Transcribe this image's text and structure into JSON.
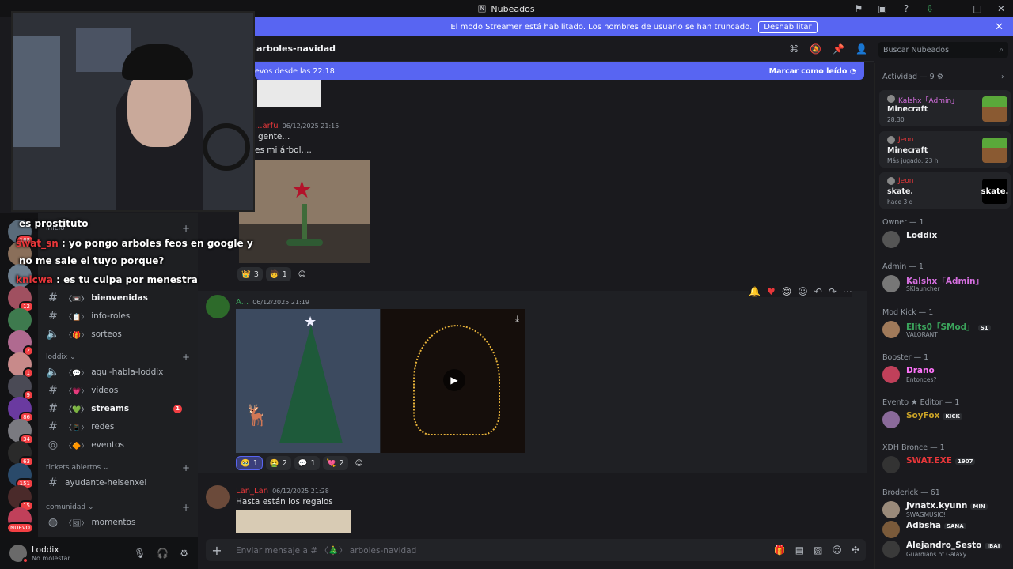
{
  "window": {
    "title": "Nubeados"
  },
  "banner": {
    "text": "El modo Streamer está habilitado. Los nombres de usuario se han truncado.",
    "button": "Deshabilitar"
  },
  "channel_header": {
    "title": "arboles-navidad"
  },
  "search": {
    "placeholder": "Buscar Nubeados"
  },
  "new_messages": {
    "text": "evos desde las 22:18",
    "mark_read": "Marcar como leído"
  },
  "stream_overlay": [
    {
      "user": "",
      "text": "es prostituto"
    },
    {
      "user": "swat_sn",
      "text": ": yo pongo arboles feos en google y"
    },
    {
      "user": "",
      "text": "no me sale el tuyo porque?"
    },
    {
      "user": "knicwa",
      "text": ": es tu culpa por menestra"
    }
  ],
  "servers": [
    {
      "badge": "168"
    },
    {
      "badge": ""
    },
    {
      "badge": ""
    },
    {
      "badge": "12"
    },
    {
      "badge": ""
    },
    {
      "badge": "2"
    },
    {
      "badge": "1"
    },
    {
      "badge": "9"
    },
    {
      "badge": "86"
    },
    {
      "badge": "34"
    },
    {
      "badge": "63"
    },
    {
      "badge": "151"
    },
    {
      "badge": "15"
    },
    {
      "badge": "NUEVO"
    }
  ],
  "channels": {
    "top": {
      "label": "inicio"
    },
    "items_a": [
      {
        "label": "bienvenidas",
        "emoji": "〈📼〉",
        "bold": true
      },
      {
        "label": "info-roles",
        "emoji": "〈📋〉",
        "bold": false
      },
      {
        "label": "sorteos",
        "emoji": "〈🎁〉",
        "bold": false
      }
    ],
    "category_b": "loddix",
    "items_b": [
      {
        "label": "aqui-habla-loddix",
        "emoji": "〈💬〉",
        "bold": false
      },
      {
        "label": "videos",
        "emoji": "〈💗〉",
        "bold": false
      },
      {
        "label": "streams",
        "emoji": "〈💚〉",
        "bold": true,
        "mention": "1"
      },
      {
        "label": "redes",
        "emoji": "〈📱〉",
        "bold": false
      },
      {
        "label": "eventos",
        "emoji": "〈🔶〉",
        "bold": false
      }
    ],
    "category_c": "tickets abiertos",
    "items_c": [
      {
        "label": "ayudante-heisenxel"
      }
    ],
    "category_d": "comunidad",
    "items_d": [
      {
        "label": "momentos",
        "emoji": "〈🖼〉"
      }
    ]
  },
  "user_panel": {
    "name": "Loddix",
    "status": "No molestar"
  },
  "messages": [
    {
      "author": "...arfu",
      "time": "06/12/2025 21:15",
      "lines": [
        "gente...",
        "es mi árbol...."
      ],
      "reactions": [
        {
          "emoji": "👑",
          "count": "3"
        },
        {
          "emoji": "🧑",
          "count": "1"
        }
      ]
    },
    {
      "author": "A...",
      "time": "06/12/2025 21:19",
      "reactions": [
        {
          "emoji": "🥹",
          "count": "1"
        },
        {
          "emoji": "🤮",
          "count": "2"
        },
        {
          "emoji": "💬",
          "count": "1"
        },
        {
          "emoji": "💘",
          "count": "2"
        }
      ]
    },
    {
      "author": "Lan_Lan",
      "time": "06/12/2025 21:28",
      "lines": [
        "Hasta están los regalos"
      ]
    }
  ],
  "composer": {
    "placeholder": "Enviar mensaje a # 〈🎄〉 arboles-navidad"
  },
  "members": {
    "activity_header": "Actividad — 9",
    "activities": [
      {
        "user": "Kalshx「Admin」",
        "game": "Minecraft",
        "sub": "28:30",
        "icon": "minecraft-icon"
      },
      {
        "user": "Jeon",
        "game": "Minecraft",
        "sub": "Más jugado: 23 h",
        "icon": "minecraft-icon"
      },
      {
        "user": "Jeon",
        "game": "skate.",
        "sub": "hace 3 d",
        "icon": "skate-icon",
        "icon_text": "skate."
      }
    ],
    "groups": [
      {
        "role": "Owner — 1",
        "members": [
          {
            "name": "Loddix",
            "color": "#f2f3f5",
            "status": ""
          }
        ]
      },
      {
        "role": "Admin — 1",
        "members": [
          {
            "name": "Kalshx「Admin」",
            "color": "#d66fe0",
            "status": "SKlauncher"
          }
        ]
      },
      {
        "role": "Mod Kick — 1",
        "members": [
          {
            "name": "Elits0「SMod」",
            "color": "#3ba55c",
            "status": "VALORANT",
            "tag": "S1"
          }
        ]
      },
      {
        "role": "Booster — 1",
        "members": [
          {
            "name": "Draño",
            "color": "#ff73fa",
            "status": "Entonces?"
          }
        ]
      },
      {
        "role": "Evento ★ Editor — 1",
        "members": [
          {
            "name": "SoyFox",
            "color": "#c9a227",
            "status": "",
            "tag": "KICK"
          }
        ]
      },
      {
        "role": "XDH Bronce — 1",
        "members": [
          {
            "name": "SWAT.EXE",
            "color": "#e8373a",
            "status": "",
            "tag": "1907"
          }
        ]
      },
      {
        "role": "Broderick — 61",
        "members": [
          {
            "name": "Jvnatx.kyunn",
            "color": "#f2f3f5",
            "status": "SWAGMUSIC!",
            "tag": "MIN"
          },
          {
            "name": "Adbsha",
            "color": "#f2f3f5",
            "status": "",
            "tag": "SANA"
          },
          {
            "name": "Alejandro_Sesto",
            "color": "#f2f3f5",
            "status": "Guardians of Galaxy",
            "tag": "IBAI"
          }
        ]
      }
    ]
  },
  "colors": {
    "accent": "#5865f2",
    "bg": "#1a1a1e",
    "danger": "#f23f43"
  }
}
